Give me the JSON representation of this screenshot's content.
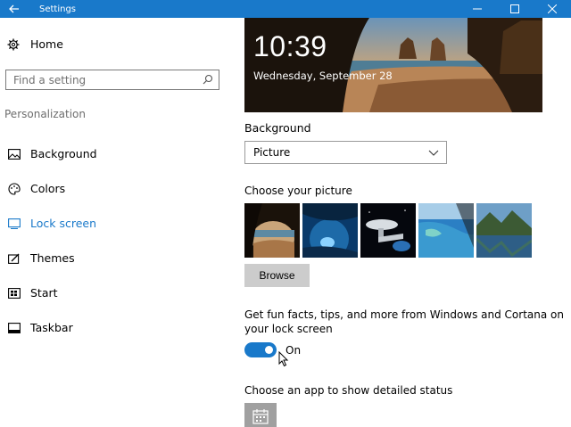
{
  "window": {
    "title": "Settings",
    "controls": {
      "minimize": "—",
      "maximize": "☐",
      "close": "✕"
    }
  },
  "sidebar": {
    "home": "Home",
    "search_placeholder": "Find a setting",
    "section": "Personalization",
    "items": [
      {
        "label": "Background",
        "icon": "picture-icon",
        "active": false
      },
      {
        "label": "Colors",
        "icon": "palette-icon",
        "active": false
      },
      {
        "label": "Lock screen",
        "icon": "lock-screen-icon",
        "active": true
      },
      {
        "label": "Themes",
        "icon": "themes-icon",
        "active": false
      },
      {
        "label": "Start",
        "icon": "start-icon",
        "active": false
      },
      {
        "label": "Taskbar",
        "icon": "taskbar-icon",
        "active": false
      }
    ]
  },
  "main": {
    "preview": {
      "time": "10:39",
      "date": "Wednesday, September 28"
    },
    "background_label": "Background",
    "background_value": "Picture",
    "choose_picture_label": "Choose your picture",
    "browse_label": "Browse",
    "fun_facts_label": "Get fun facts, tips, and more from Windows and Cortana on your lock screen",
    "toggle_state": "On",
    "detailed_status_label": "Choose an app to show detailed status"
  },
  "colors": {
    "accent": "#1979ca",
    "title_bar": "#1979ca"
  }
}
